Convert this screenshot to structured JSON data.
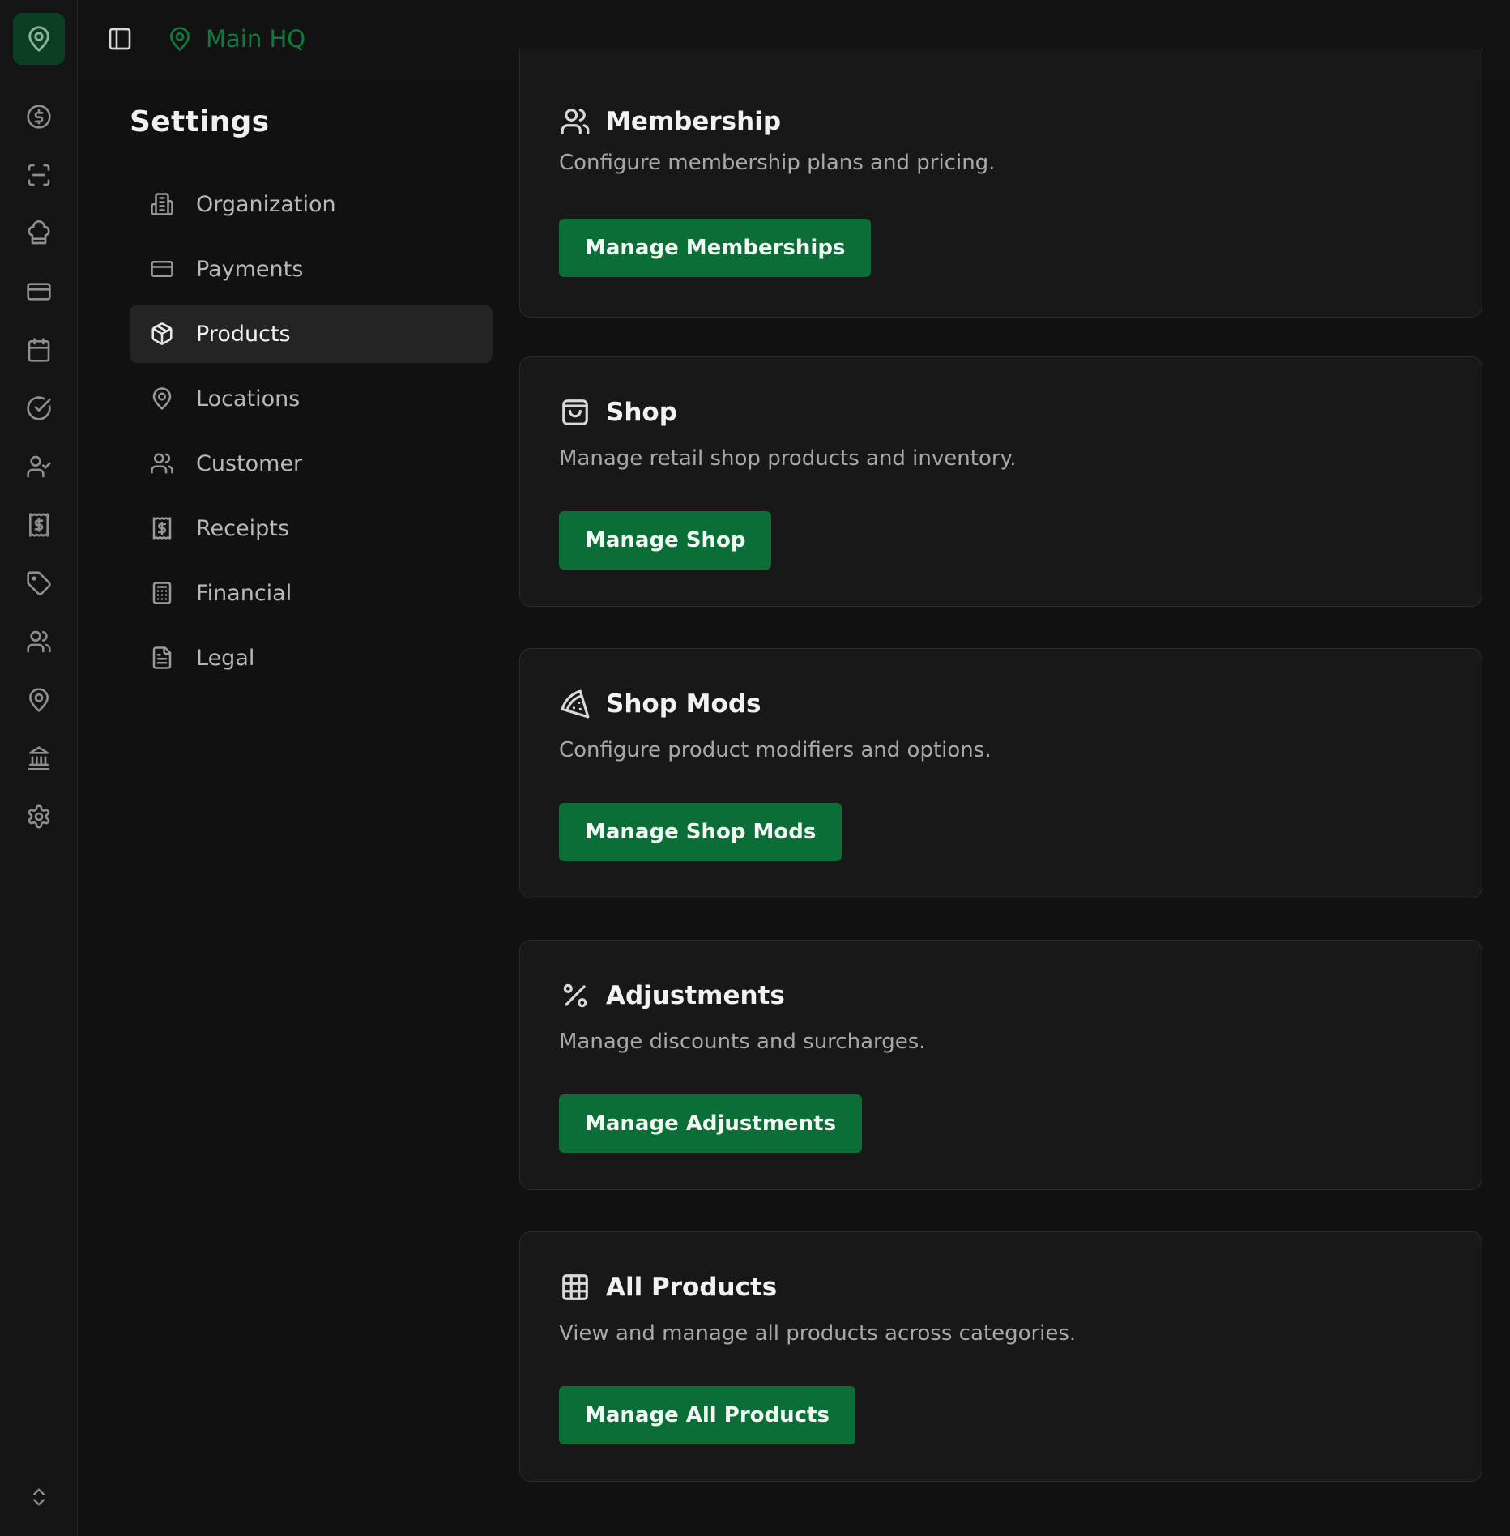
{
  "header": {
    "location_name": "Main HQ"
  },
  "rail": {
    "icons": [
      "map-pin-icon",
      "dollar-circle-icon",
      "scan-icon",
      "chef-hat-icon",
      "credit-card-icon",
      "calendar-icon",
      "check-circle-icon",
      "user-check-icon",
      "receipt-icon",
      "tag-icon",
      "users-icon",
      "map-pin-icon",
      "bank-icon",
      "gear-icon",
      "chevrons-up-down-icon"
    ]
  },
  "settings": {
    "title": "Settings",
    "nav": [
      {
        "label": "Organization",
        "icon": "building-icon",
        "active": false
      },
      {
        "label": "Payments",
        "icon": "credit-card-icon",
        "active": false
      },
      {
        "label": "Products",
        "icon": "box-icon",
        "active": true
      },
      {
        "label": "Locations",
        "icon": "map-pin-icon",
        "active": false
      },
      {
        "label": "Customer",
        "icon": "users-icon",
        "active": false
      },
      {
        "label": "Receipts",
        "icon": "receipt-icon",
        "active": false
      },
      {
        "label": "Financial",
        "icon": "calculator-icon",
        "active": false
      },
      {
        "label": "Legal",
        "icon": "file-text-icon",
        "active": false
      }
    ]
  },
  "cards": [
    {
      "title": "Membership",
      "description": "Configure membership plans and pricing.",
      "button": "Manage Memberships",
      "icon": "users-icon"
    },
    {
      "title": "Shop",
      "description": "Manage retail shop products and inventory.",
      "button": "Manage Shop",
      "icon": "shopping-bag-icon"
    },
    {
      "title": "Shop Mods",
      "description": "Configure product modifiers and options.",
      "button": "Manage Shop Mods",
      "icon": "pizza-icon"
    },
    {
      "title": "Adjustments",
      "description": "Manage discounts and surcharges.",
      "button": "Manage Adjustments",
      "icon": "percent-icon"
    },
    {
      "title": "All Products",
      "description": "View and manage all products across categories.",
      "button": "Manage All Products",
      "icon": "grid-icon"
    }
  ],
  "colors": {
    "accent": "#0b6e36",
    "location_text": "#0f7a3c",
    "background": "#111111",
    "card": "#181818"
  }
}
